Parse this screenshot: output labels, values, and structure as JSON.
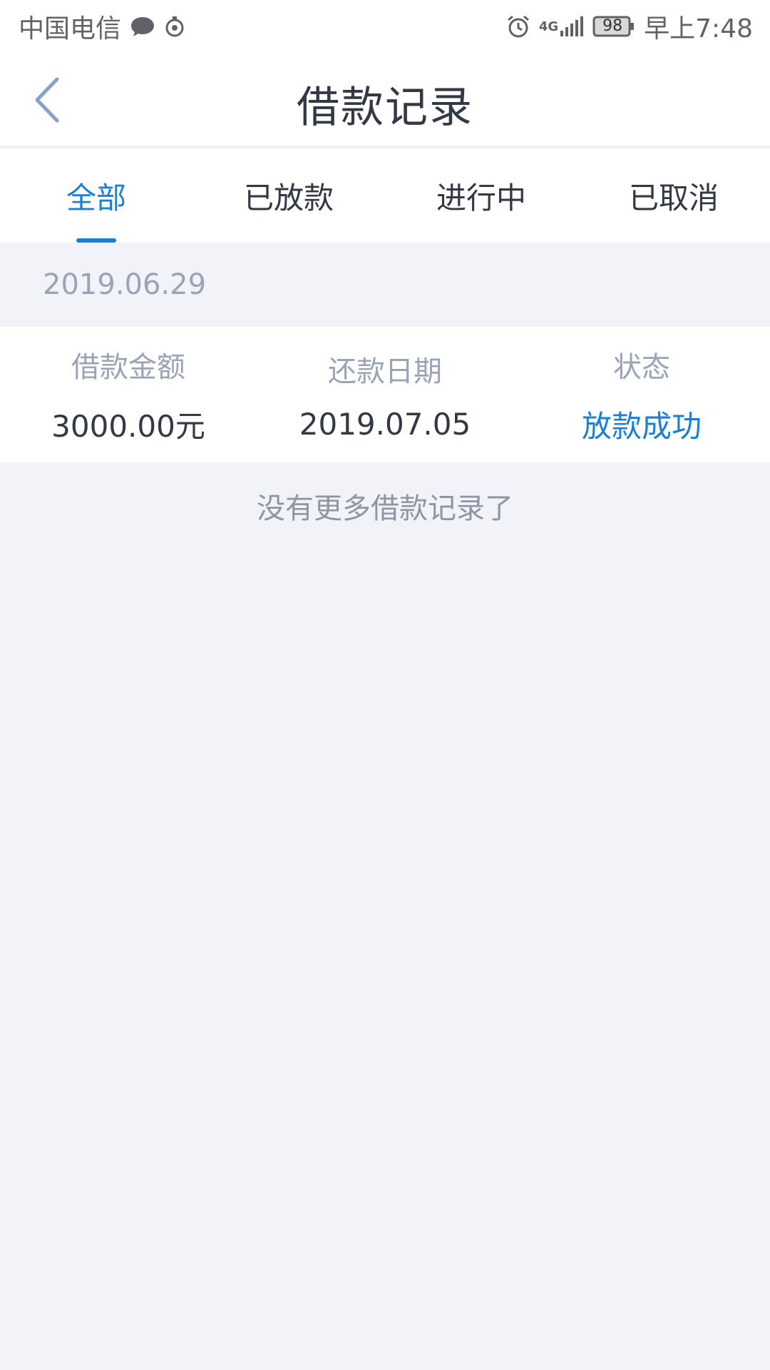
{
  "status_bar": {
    "carrier": "中国电信",
    "network": "4G",
    "battery": "98",
    "time": "早上7:48",
    "icons": [
      "message-bubble-icon",
      "target-icon",
      "alarm-icon",
      "signal-icon",
      "battery-icon"
    ]
  },
  "nav": {
    "title": "借款记录",
    "back_icon": "chevron-left-icon"
  },
  "tabs": [
    {
      "label": "全部",
      "active": true
    },
    {
      "label": "已放款",
      "active": false
    },
    {
      "label": "进行中",
      "active": false
    },
    {
      "label": "已取消",
      "active": false
    }
  ],
  "records": [
    {
      "date": "2019.06.29",
      "fields": [
        {
          "label": "借款金额",
          "value": "3000.00元"
        },
        {
          "label": "还款日期",
          "value": "2019.07.05"
        },
        {
          "label": "状态",
          "value": "放款成功"
        }
      ]
    }
  ],
  "footer_text": "没有更多借款记录了",
  "colors": {
    "accent": "#1b7fd6",
    "background": "#f2f3f8",
    "text_primary": "#333845",
    "text_secondary": "#9aa4b6"
  }
}
